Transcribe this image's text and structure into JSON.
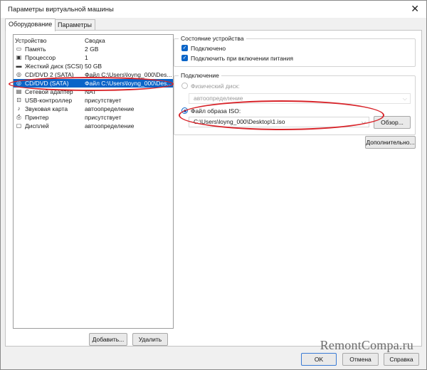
{
  "window": {
    "title": "Параметры виртуальной машины",
    "close": "✕"
  },
  "tabs": [
    {
      "label": "Оборудование",
      "active": true
    },
    {
      "label": "Параметры",
      "active": false
    }
  ],
  "device_list": {
    "headers": [
      "Устройство",
      "Сводка"
    ],
    "rows": [
      {
        "icon": "memory-icon",
        "glyph": "▭",
        "device": "Память",
        "summary": "2 GB"
      },
      {
        "icon": "cpu-icon",
        "glyph": "▣",
        "device": "Процессор",
        "summary": "1"
      },
      {
        "icon": "hard-disk-icon",
        "glyph": "▬",
        "device": "Жесткий диск (SCSI)",
        "summary": "50 GB"
      },
      {
        "icon": "cd-dvd-icon",
        "glyph": "◎",
        "device": "CD/DVD 2 (SATA)",
        "summary": "Файл C:\\Users\\loyng_000\\Des..."
      },
      {
        "icon": "cd-dvd-icon",
        "glyph": "◎",
        "device": "CD/DVD (SATA)",
        "summary": "Файл C:\\Users\\loyng_000\\Des...",
        "selected": true
      },
      {
        "icon": "network-adapter-icon",
        "glyph": "▤",
        "device": "Сетевой адаптер",
        "summary": "NAT"
      },
      {
        "icon": "usb-icon",
        "glyph": "⊡",
        "device": "USB-контроллер",
        "summary": "присутствует"
      },
      {
        "icon": "sound-card-icon",
        "glyph": "♪",
        "device": "Звуковая карта",
        "summary": "автоопределение"
      },
      {
        "icon": "printer-icon",
        "glyph": "⎙",
        "device": "Принтер",
        "summary": "присутствует"
      },
      {
        "icon": "display-icon",
        "glyph": "▢",
        "device": "Дисплей",
        "summary": "автоопределение"
      }
    ],
    "add_label": "Добавить...",
    "remove_label": "Удалить"
  },
  "device_status": {
    "title": "Состояние устройства",
    "connected_label": "Подключено",
    "connected_checked": true,
    "connect_on_power_label": "Подключить при включении питания",
    "connect_on_power_checked": true
  },
  "connection": {
    "title": "Подключение",
    "physical_label": "Физический диск:",
    "physical_value": "автоопределение",
    "iso_label": "Файл образа ISO:",
    "iso_value": "C:\\Users\\loyng_000\\Desktop\\1.iso",
    "browse_label": "Обзор...",
    "selected_option": "iso"
  },
  "advanced_label": "Дополнительно...",
  "footer": {
    "ok": "OK",
    "cancel": "Отмена",
    "help": "Справка"
  },
  "watermark": "RemontCompa.ru",
  "colors": {
    "accent": "#0a64c8",
    "highlight_ring": "#d8242a"
  }
}
